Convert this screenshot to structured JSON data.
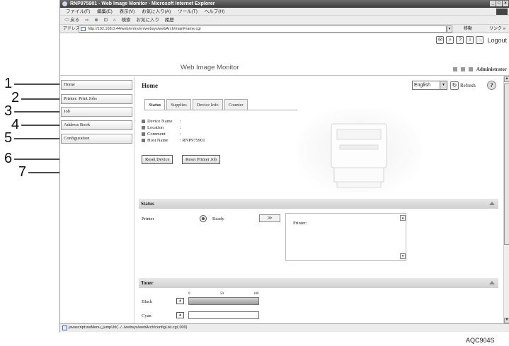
{
  "browser": {
    "title": "RNP975901 - Web Image Monitor - Microsoft Internet Explorer",
    "menu": [
      "ファイル(F)",
      "編集(E)",
      "表示(V)",
      "お気に入り(A)",
      "ツール(T)",
      "ヘルプ(H)"
    ],
    "toolbar": [
      "⇦ 戻る",
      "⇨",
      "⊗",
      "⊡",
      "⌂",
      "検索",
      "お気に入り",
      "履歴"
    ],
    "address_label": "アドレス(D)",
    "url": "http://192.168.0.44/web/entry/en/websys/webArch/mainFrame.cgi",
    "go_label": "移動",
    "links_label": "リンク »",
    "status_text": "javascript:wsMenu_jumpUrl('../../websys/webArch/configList.cgi',000)"
  },
  "header": {
    "app_title": "Web Image Monitor",
    "logout": "Logout",
    "user": "Administrator"
  },
  "menu": {
    "items": [
      {
        "label": "Home"
      },
      {
        "label": "Printer: Print Jobs"
      },
      {
        "label": "Job"
      },
      {
        "label": "Address Book"
      },
      {
        "label": "Configuration"
      }
    ]
  },
  "main": {
    "title": "Home",
    "language": "English",
    "refresh": "Refresh",
    "tabs": [
      {
        "label": "Status"
      },
      {
        "label": "Supplies"
      },
      {
        "label": "Device Info"
      },
      {
        "label": "Counter"
      }
    ],
    "info": [
      {
        "label": "Device Name",
        "value": ":"
      },
      {
        "label": "Location",
        "value": ":"
      },
      {
        "label": "Comment",
        "value": ":"
      },
      {
        "label": "Host Name",
        "value": ": RNP975901"
      }
    ],
    "reset_device": "Reset Device",
    "reset_printer_job": "Reset Printer Job"
  },
  "status_panel": {
    "title": "Status",
    "printer_label": "Printer",
    "state": "Ready",
    "box_text": "Printer:"
  },
  "toner_panel": {
    "title": "Toner",
    "scale": [
      "0",
      "50",
      "100"
    ],
    "items": [
      {
        "label": "Black",
        "level": 1.0
      },
      {
        "label": "Cyan",
        "level": 0.0
      }
    ]
  },
  "callouts": [
    "1",
    "2",
    "3",
    "4",
    "5",
    "6",
    "7"
  ],
  "caption": "AQC904S"
}
